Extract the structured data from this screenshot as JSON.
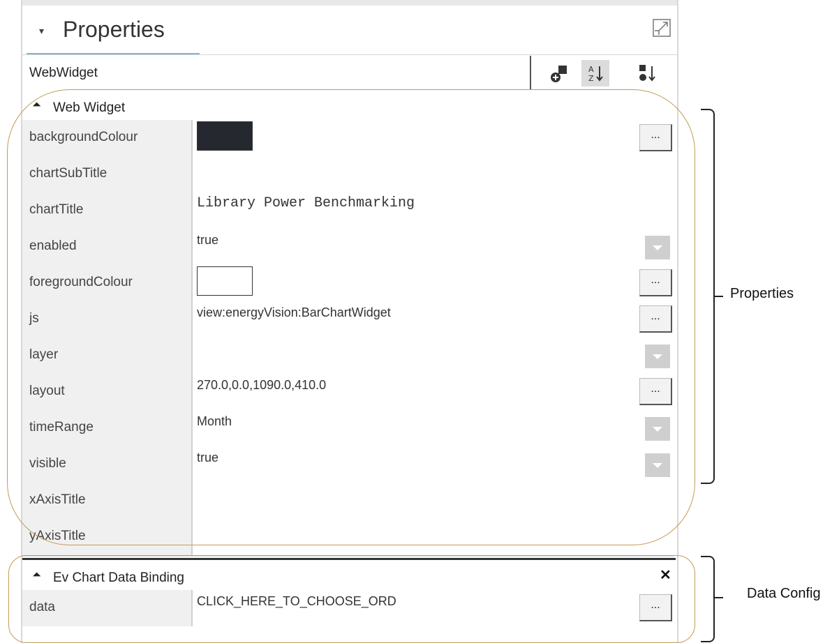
{
  "panel": {
    "tab_title": "Properties",
    "widget_name": "WebWidget"
  },
  "sections": {
    "web_widget": "Web Widget",
    "binding": "Ev Chart Data Binding"
  },
  "properties": [
    {
      "name": "backgroundColour",
      "kind": "color",
      "color": "#25282e",
      "editor": "dots"
    },
    {
      "name": "chartSubTitle",
      "kind": "text",
      "value": ""
    },
    {
      "name": "chartTitle",
      "kind": "mono",
      "value": "Library Power Benchmarking"
    },
    {
      "name": "enabled",
      "kind": "text",
      "value": "true",
      "editor": "dropdown"
    },
    {
      "name": "foregroundColour",
      "kind": "color",
      "color": "#ffffff",
      "editor": "dots"
    },
    {
      "name": "js",
      "kind": "text",
      "value": "view:energyVision:BarChartWidget",
      "editor": "dots"
    },
    {
      "name": "layer",
      "kind": "text",
      "value": "",
      "editor": "dropdown"
    },
    {
      "name": "layout",
      "kind": "text",
      "value": "270.0,0.0,1090.0,410.0",
      "editor": "dots"
    },
    {
      "name": "timeRange",
      "kind": "text",
      "value": "Month",
      "editor": "dropdown"
    },
    {
      "name": "visible",
      "kind": "text",
      "value": "true",
      "editor": "dropdown"
    },
    {
      "name": "xAxisTitle",
      "kind": "text",
      "value": ""
    },
    {
      "name": "yAxisTitle",
      "kind": "text",
      "value": ""
    }
  ],
  "binding": {
    "name": "data",
    "value": "CLICK_HERE_TO_CHOOSE_ORD",
    "editor_label": "..."
  },
  "dots_label": "...",
  "annotations": {
    "properties": "Properties",
    "data_config": "Data Config"
  },
  "icons": [
    "maximize-icon",
    "add-slot-icon",
    "sort-az-icon",
    "sort-order-icon",
    "collapse-icon",
    "close-icon"
  ]
}
